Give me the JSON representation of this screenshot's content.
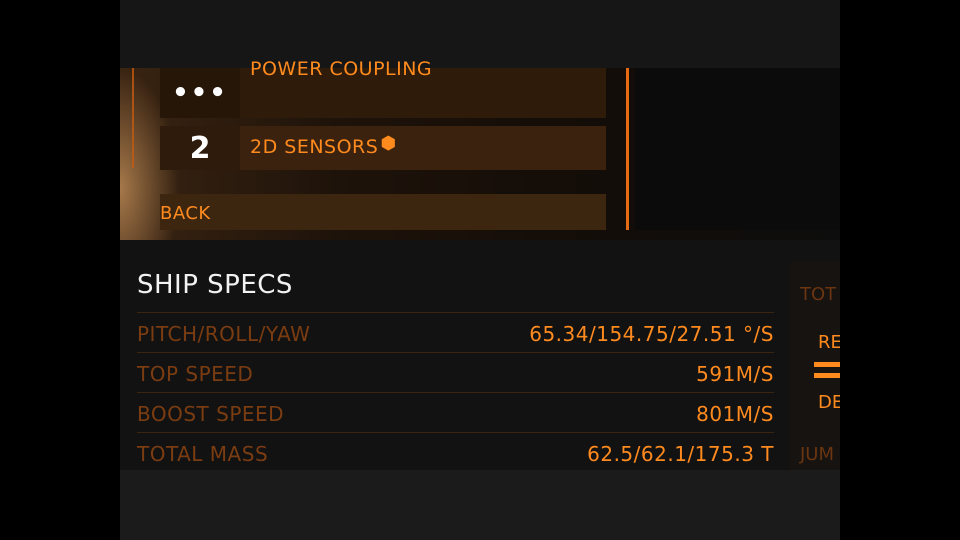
{
  "menu": {
    "modules": [
      {
        "icon_name": "more-dots-icon",
        "icon_glyph": "•••",
        "label": "POWER COUPLING"
      },
      {
        "icon_name": "class-number-icon",
        "icon_glyph": "2",
        "label": "2D SENSORS",
        "badge": "engineered-badge-icon",
        "badge_glyph": "⬢"
      }
    ],
    "back_label": "BACK"
  },
  "specs": {
    "title": "SHIP SPECS",
    "rows": [
      {
        "label": "PITCH/ROLL/YAW",
        "value": "65.34/154.75/27.51 °/S"
      },
      {
        "label": "TOP SPEED",
        "value": "591M/S"
      },
      {
        "label": "BOOST SPEED",
        "value": "801M/S"
      },
      {
        "label": "TOTAL MASS",
        "value": "62.5/62.1/175.3 T"
      }
    ]
  },
  "side": {
    "tot": "TOT",
    "re": "RE",
    "de": "DE",
    "jum": "JUM"
  },
  "colors": {
    "accent": "#ff8a1e",
    "label_dim": "#7a3c10",
    "title": "#f2f2f2"
  }
}
